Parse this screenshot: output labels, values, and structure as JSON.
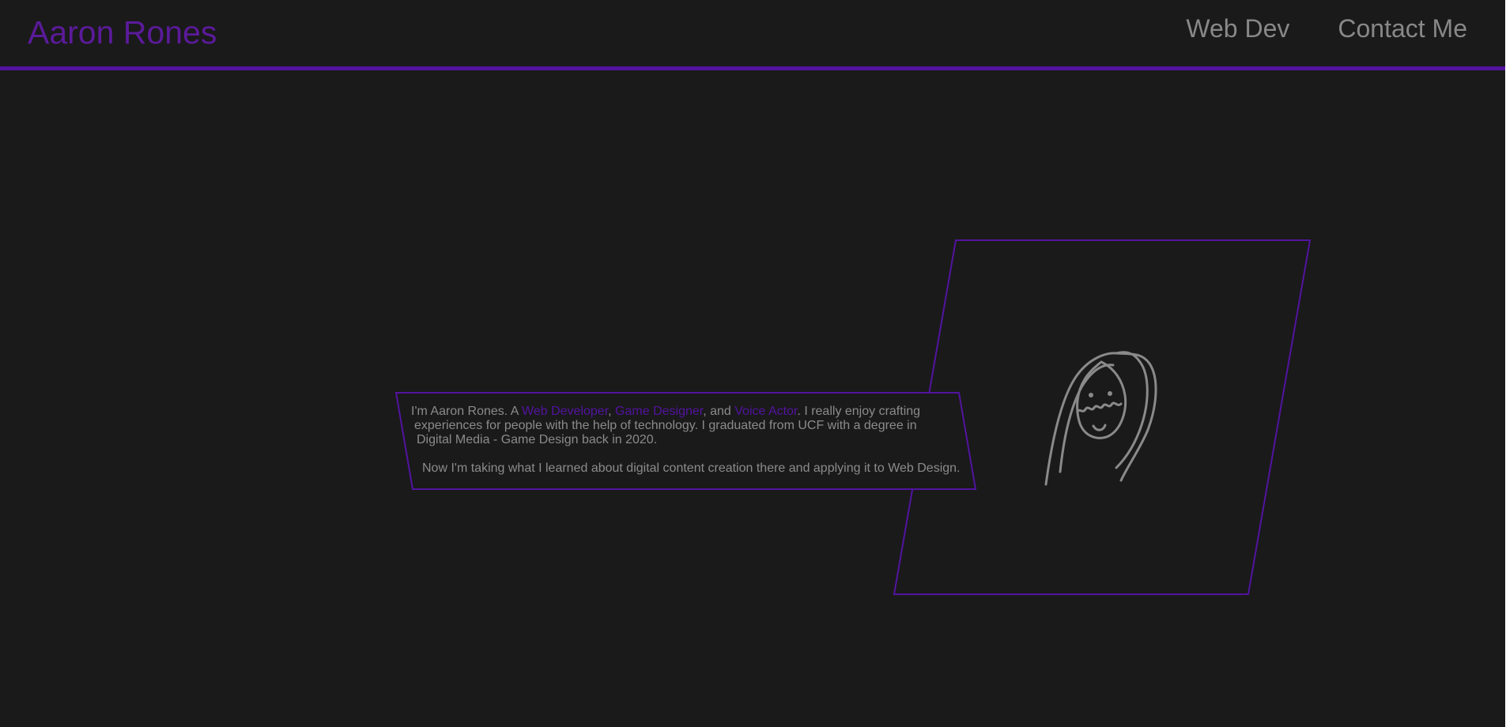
{
  "header": {
    "brand": "Aaron Rones",
    "nav": [
      {
        "label": "Web Dev"
      },
      {
        "label": "Contact Me"
      }
    ]
  },
  "intro": {
    "line1_prefix": "I'm Aaron Rones. A ",
    "role_web": "Web Developer",
    "comma": ",",
    "role_game": "Game Designer",
    "and_text": ", and ",
    "role_voice": "Voice Actor",
    "line1_suffix": ". I really enjoy crafting",
    "line2": "experiences for people with the help of technology. I graduated from UCF with a degree in",
    "line3": "Digital Media - Game Design back in 2020.",
    "line4": "Now I'm taking what I learned about digital content creation there and applying it to Web Design."
  },
  "colors": {
    "accent": "#52139f",
    "brand": "#5b1a9a",
    "background": "#1a1a1a",
    "text": "#8b8b8b"
  },
  "icons": {
    "portrait": "portrait-doodle-icon"
  }
}
